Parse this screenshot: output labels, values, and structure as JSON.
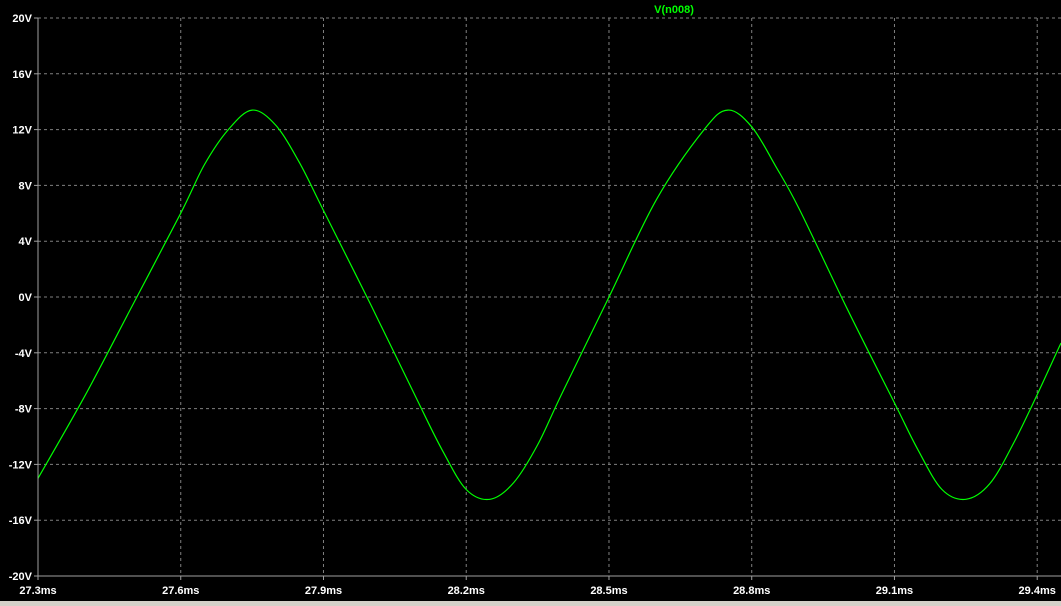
{
  "chart_data": {
    "type": "line",
    "title": "V(n008)",
    "xlabel": "",
    "ylabel": "",
    "xlim": [
      27.3,
      29.45
    ],
    "ylim": [
      -20,
      20
    ],
    "grid": true,
    "x_ticks": [
      "27.3ms",
      "27.6ms",
      "27.9ms",
      "28.2ms",
      "28.5ms",
      "28.8ms",
      "29.1ms",
      "29.4ms"
    ],
    "x_tick_values": [
      27.3,
      27.6,
      27.9,
      28.2,
      28.5,
      28.8,
      29.1,
      29.4
    ],
    "y_ticks": [
      "20V",
      "16V",
      "12V",
      "8V",
      "4V",
      "0V",
      "-4V",
      "-8V",
      "-12V",
      "-16V",
      "-20V"
    ],
    "y_tick_values": [
      20,
      16,
      12,
      8,
      4,
      0,
      -4,
      -8,
      -12,
      -16,
      -20
    ],
    "series": [
      {
        "name": "V(n008)",
        "color": "#00ff00",
        "x": [
          27.3,
          27.4,
          27.5,
          27.6,
          27.65,
          27.7,
          27.75,
          27.8,
          27.85,
          27.9,
          28.0,
          28.1,
          28.15,
          28.2,
          28.25,
          28.3,
          28.35,
          28.4,
          28.5,
          28.6,
          28.7,
          28.75,
          28.8,
          28.85,
          28.9,
          29.0,
          29.1,
          29.15,
          29.2,
          29.25,
          29.3,
          29.35,
          29.4,
          29.45
        ],
        "y": [
          -13.0,
          -7.0,
          -0.5,
          6.0,
          9.5,
          12.0,
          13.4,
          12.3,
          9.6,
          6.2,
          -0.6,
          -7.6,
          -11.0,
          -13.8,
          -14.5,
          -13.3,
          -10.6,
          -7.0,
          0.0,
          7.0,
          12.0,
          13.4,
          12.2,
          9.4,
          6.3,
          -0.8,
          -7.6,
          -11.0,
          -13.8,
          -14.5,
          -13.4,
          -10.5,
          -7.0,
          -3.3
        ]
      }
    ]
  }
}
